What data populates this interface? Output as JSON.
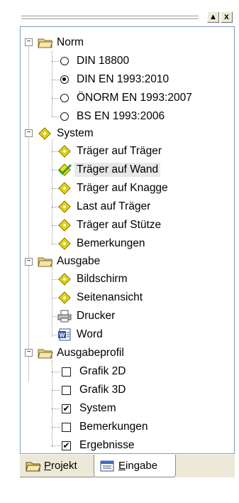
{
  "tree": {
    "norm": {
      "label": "Norm",
      "options": [
        {
          "label": "DIN 18800",
          "selected": false
        },
        {
          "label": "DIN EN 1993:2010",
          "selected": true
        },
        {
          "label": "ÖNORM EN 1993:2007",
          "selected": false
        },
        {
          "label": "BS EN 1993:2006",
          "selected": false
        }
      ]
    },
    "system": {
      "label": "System",
      "items": [
        {
          "label": "Träger auf Träger",
          "icon": "diamond-icon"
        },
        {
          "label": "Träger auf Wand",
          "icon": "check-diamond-icon",
          "selected": true
        },
        {
          "label": "Träger auf Knagge",
          "icon": "diamond-icon"
        },
        {
          "label": "Last auf Träger",
          "icon": "diamond-icon"
        },
        {
          "label": "Träger auf Stütze",
          "icon": "diamond-icon"
        },
        {
          "label": "Bemerkungen",
          "icon": "diamond-icon"
        }
      ]
    },
    "ausgabe": {
      "label": "Ausgabe",
      "items": [
        {
          "label": "Bildschirm",
          "icon": "diamond-icon"
        },
        {
          "label": "Seitenansicht",
          "icon": "diamond-icon"
        },
        {
          "label": "Drucker",
          "icon": "printer-icon"
        },
        {
          "label": "Word",
          "icon": "word-icon"
        }
      ]
    },
    "ausgabeprofil": {
      "label": "Ausgabeprofil",
      "items": [
        {
          "label": "Grafik 2D",
          "checked": false
        },
        {
          "label": "Grafik 3D",
          "checked": false
        },
        {
          "label": "System",
          "checked": true
        },
        {
          "label": "Bemerkungen",
          "checked": false
        },
        {
          "label": "Ergebnisse",
          "checked": true
        }
      ]
    }
  },
  "tabs": {
    "projekt_prefix": "P",
    "projekt_rest": "rojekt",
    "eingabe_prefix": "E",
    "eingabe_rest": "ingabe"
  },
  "window": {
    "restore_glyph": "▴",
    "close_glyph": "x"
  },
  "colors": {
    "diamond": "#f2e200",
    "folder": "#e8d27a",
    "check": "#2fa02f",
    "selection": "#e8e8e8"
  }
}
